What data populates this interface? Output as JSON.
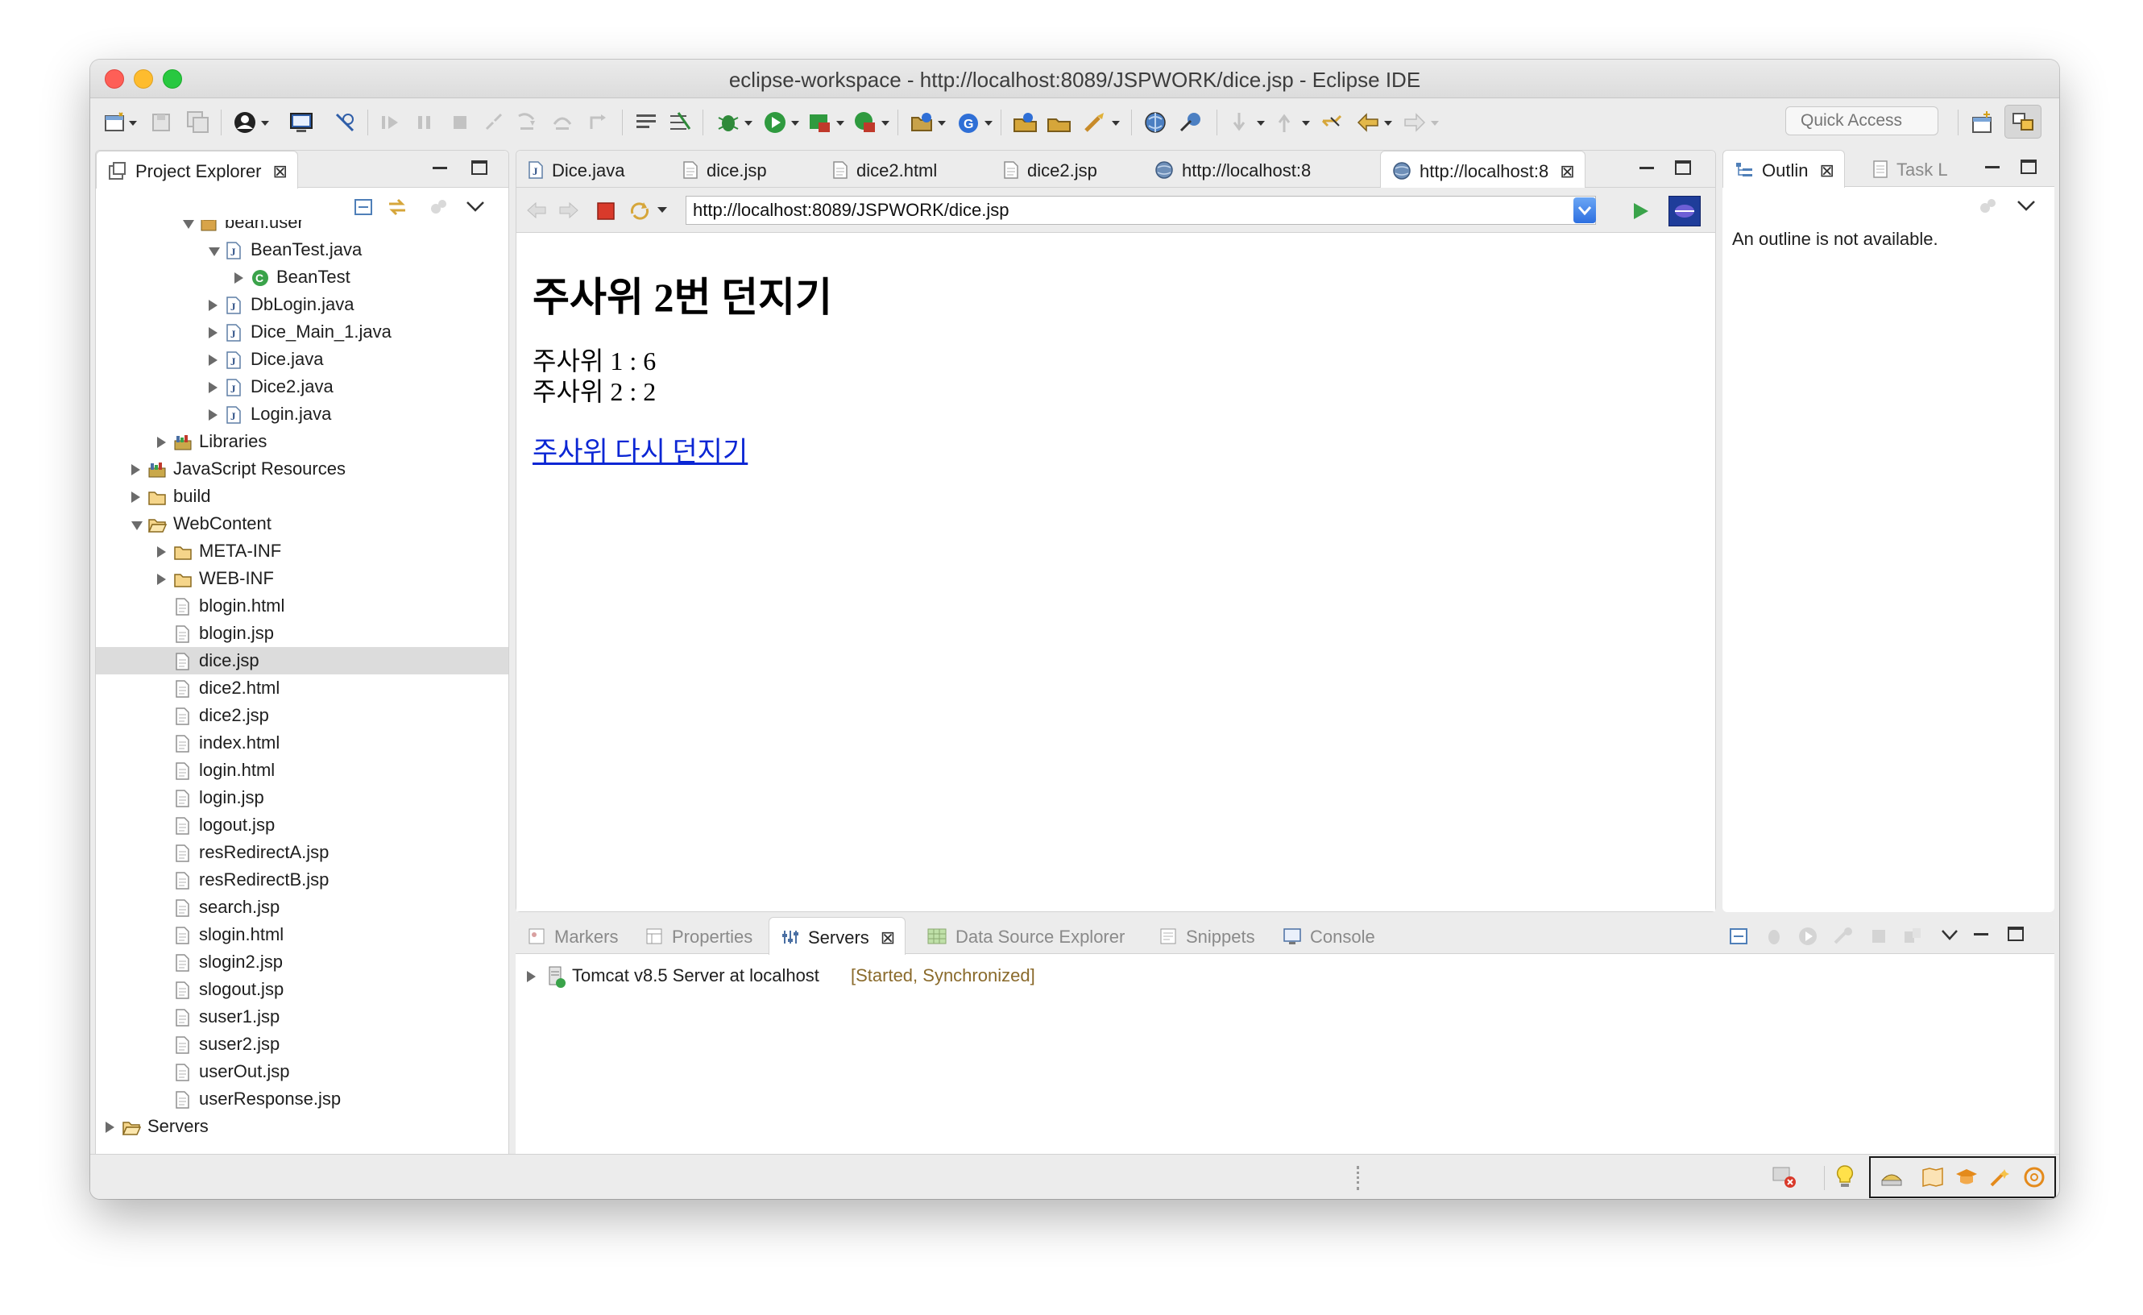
{
  "window": {
    "title": "eclipse-workspace - http://localhost:8089/JSPWORK/dice.jsp - Eclipse IDE"
  },
  "toolbar": {
    "quick_access_placeholder": "Quick Access"
  },
  "project_explorer": {
    "tab_label": "Project Explorer",
    "tree": [
      {
        "label": "bean.user",
        "depth": 4,
        "state": "open",
        "icon": "package-icon"
      },
      {
        "label": "BeanTest.java",
        "depth": 5,
        "state": "open",
        "icon": "java-file-icon"
      },
      {
        "label": "BeanTest",
        "depth": 6,
        "state": "closed",
        "icon": "class-icon"
      },
      {
        "label": "DbLogin.java",
        "depth": 5,
        "state": "closed",
        "icon": "java-file-icon"
      },
      {
        "label": "Dice_Main_1.java",
        "depth": 5,
        "state": "closed",
        "icon": "java-file-icon"
      },
      {
        "label": "Dice.java",
        "depth": 5,
        "state": "closed",
        "icon": "java-file-icon"
      },
      {
        "label": "Dice2.java",
        "depth": 5,
        "state": "closed",
        "icon": "java-file-icon"
      },
      {
        "label": "Login.java",
        "depth": 5,
        "state": "closed",
        "icon": "java-file-icon"
      },
      {
        "label": "Libraries",
        "depth": 3,
        "state": "closed",
        "icon": "library-icon"
      },
      {
        "label": "JavaScript Resources",
        "depth": 2,
        "state": "closed",
        "icon": "library-icon"
      },
      {
        "label": "build",
        "depth": 2,
        "state": "closed",
        "icon": "folder-icon"
      },
      {
        "label": "WebContent",
        "depth": 2,
        "state": "open",
        "icon": "folder-open-icon"
      },
      {
        "label": "META-INF",
        "depth": 3,
        "state": "closed",
        "icon": "folder-icon"
      },
      {
        "label": "WEB-INF",
        "depth": 3,
        "state": "closed",
        "icon": "folder-icon"
      },
      {
        "label": "blogin.html",
        "depth": 3,
        "state": "none",
        "icon": "file-icon"
      },
      {
        "label": "blogin.jsp",
        "depth": 3,
        "state": "none",
        "icon": "file-icon"
      },
      {
        "label": "dice.jsp",
        "depth": 3,
        "state": "none",
        "icon": "file-icon",
        "selected": true
      },
      {
        "label": "dice2.html",
        "depth": 3,
        "state": "none",
        "icon": "file-icon"
      },
      {
        "label": "dice2.jsp",
        "depth": 3,
        "state": "none",
        "icon": "file-icon"
      },
      {
        "label": "index.html",
        "depth": 3,
        "state": "none",
        "icon": "file-icon"
      },
      {
        "label": "login.html",
        "depth": 3,
        "state": "none",
        "icon": "file-icon"
      },
      {
        "label": "login.jsp",
        "depth": 3,
        "state": "none",
        "icon": "file-icon"
      },
      {
        "label": "logout.jsp",
        "depth": 3,
        "state": "none",
        "icon": "file-icon"
      },
      {
        "label": "resRedirectA.jsp",
        "depth": 3,
        "state": "none",
        "icon": "file-icon"
      },
      {
        "label": "resRedirectB.jsp",
        "depth": 3,
        "state": "none",
        "icon": "file-icon"
      },
      {
        "label": "search.jsp",
        "depth": 3,
        "state": "none",
        "icon": "file-icon"
      },
      {
        "label": "slogin.html",
        "depth": 3,
        "state": "none",
        "icon": "file-icon"
      },
      {
        "label": "slogin2.jsp",
        "depth": 3,
        "state": "none",
        "icon": "file-icon"
      },
      {
        "label": "slogout.jsp",
        "depth": 3,
        "state": "none",
        "icon": "file-icon"
      },
      {
        "label": "suser1.jsp",
        "depth": 3,
        "state": "none",
        "icon": "file-icon"
      },
      {
        "label": "suser2.jsp",
        "depth": 3,
        "state": "none",
        "icon": "file-icon"
      },
      {
        "label": "userOut.jsp",
        "depth": 3,
        "state": "none",
        "icon": "file-icon"
      },
      {
        "label": "userResponse.jsp",
        "depth": 3,
        "state": "none",
        "icon": "file-icon"
      },
      {
        "label": "Servers",
        "depth": 1,
        "state": "closed",
        "icon": "folder-open-icon"
      }
    ]
  },
  "editor": {
    "tabs": [
      {
        "label": "Dice.java",
        "icon": "java-file-icon"
      },
      {
        "label": "dice.jsp",
        "icon": "file-icon"
      },
      {
        "label": "dice2.html",
        "icon": "file-icon"
      },
      {
        "label": "dice2.jsp",
        "icon": "file-icon"
      },
      {
        "label": "http://localhost:8",
        "icon": "globe-icon"
      },
      {
        "label": "http://localhost:8",
        "icon": "globe-icon",
        "active": true
      }
    ],
    "url": "http://localhost:8089/JSPWORK/dice.jsp",
    "page": {
      "heading": "주사위 2번 던지기",
      "lines": [
        "주사위 1 : 6",
        "주사위 2 : 2"
      ],
      "link": "주사위 다시 던지기"
    }
  },
  "outline": {
    "tab_label": "Outlin",
    "task_tab_label": "Task L",
    "message": "An outline is not available."
  },
  "bottom": {
    "tabs": [
      {
        "label": "Markers",
        "icon": "markers-icon"
      },
      {
        "label": "Properties",
        "icon": "properties-icon"
      },
      {
        "label": "Servers",
        "icon": "servers-icon",
        "active": true
      },
      {
        "label": "Data Source Explorer",
        "icon": "data-source-icon"
      },
      {
        "label": "Snippets",
        "icon": "snippets-icon"
      },
      {
        "label": "Console",
        "icon": "console-icon"
      }
    ],
    "server": {
      "name": "Tomcat v8.5 Server at localhost",
      "status": "[Started, Synchronized]"
    }
  },
  "colors": {
    "accent": "#2d6fe0",
    "status_text": "#8a6a2b",
    "selection": "#dcdcdc",
    "link": "#0b26d4"
  }
}
